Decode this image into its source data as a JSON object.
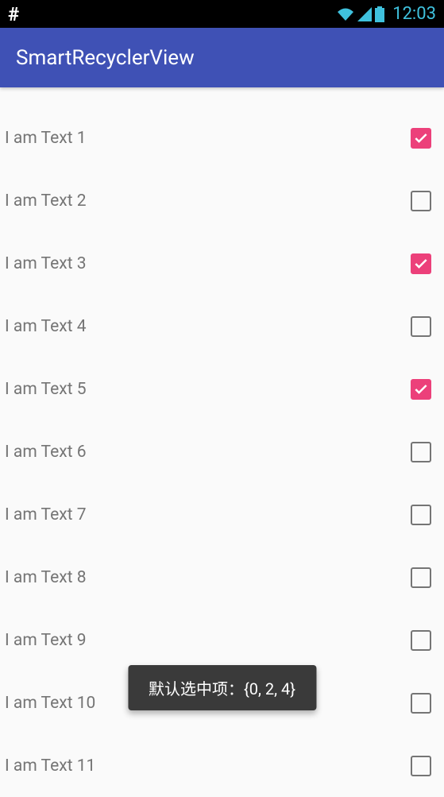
{
  "status": {
    "clock": "12:03"
  },
  "appBar": {
    "title": "SmartRecyclerView"
  },
  "list": {
    "items": [
      {
        "label": "I am Text 1",
        "checked": true
      },
      {
        "label": "I am Text 2",
        "checked": false
      },
      {
        "label": "I am Text 3",
        "checked": true
      },
      {
        "label": "I am Text 4",
        "checked": false
      },
      {
        "label": "I am Text 5",
        "checked": true
      },
      {
        "label": "I am Text 6",
        "checked": false
      },
      {
        "label": "I am Text 7",
        "checked": false
      },
      {
        "label": "I am Text 8",
        "checked": false
      },
      {
        "label": "I am Text 9",
        "checked": false
      },
      {
        "label": "I am Text 10",
        "checked": false
      },
      {
        "label": "I am Text 11",
        "checked": false
      }
    ]
  },
  "toast": {
    "message": "默认选中项：{0, 2, 4}"
  }
}
